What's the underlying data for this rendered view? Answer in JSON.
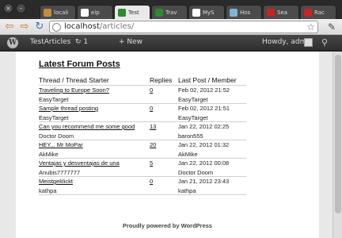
{
  "browser": {
    "tabs": [
      {
        "title": "locali",
        "fav_color": "#c98a3a"
      },
      {
        "title": "eip",
        "fav_color": "#ffffff"
      },
      {
        "title": "Test",
        "fav_color": "#2e8b2e"
      },
      {
        "title": "Trav",
        "fav_color": "#2e8b2e"
      },
      {
        "title": "MyS",
        "fav_color": "#ffffff"
      },
      {
        "title": "Hos",
        "fav_color": "#7fb3d5"
      },
      {
        "title": "Sea",
        "fav_color": "#cc2222"
      },
      {
        "title": "Rac",
        "fav_color": "#cc2222"
      }
    ],
    "url_host": "localhost",
    "url_path": "/articles/"
  },
  "adminbar": {
    "site_name": "TestArticles",
    "updates_count": "1",
    "new_label": "New",
    "greeting": "Howdy, admin"
  },
  "forum": {
    "title": "Latest Forum Posts",
    "headers": {
      "thread": "Thread / Thread Starter",
      "replies": "Replies",
      "last_post": "Last Post / Member"
    },
    "rows": [
      {
        "thread": "Traveling to Europe Soon?",
        "starter": "EasyTarget",
        "replies": "0",
        "date": "Feb 02, 2012 21:52",
        "member": "EasyTarget"
      },
      {
        "thread": "Sample thread posting",
        "starter": "EasyTarget",
        "replies": "0",
        "date": "Feb 02, 2012 21:51",
        "member": "EasyTarget"
      },
      {
        "thread": "Can you recommend me some good",
        "starter": "Doctor Doom",
        "replies": "13",
        "date": "Jan 22, 2012 02:25",
        "member": "baron555"
      },
      {
        "thread": "HEY... Mr MoPar",
        "starter": "AkMike",
        "replies": "20",
        "date": "Jan 22, 2012 01:32",
        "member": "AkMike"
      },
      {
        "thread": "Ventajas y desventajas de una",
        "starter": "Anubis7777777",
        "replies": "5",
        "date": "Jan 22, 2012 00:08",
        "member": "Doctor Doom"
      },
      {
        "thread": "Meistgeklickt",
        "starter": "kathpa",
        "replies": "0",
        "date": "Jan 21, 2012 23:43",
        "member": "kathpa"
      }
    ]
  },
  "footer": {
    "text": "Proudly powered by WordPress"
  }
}
